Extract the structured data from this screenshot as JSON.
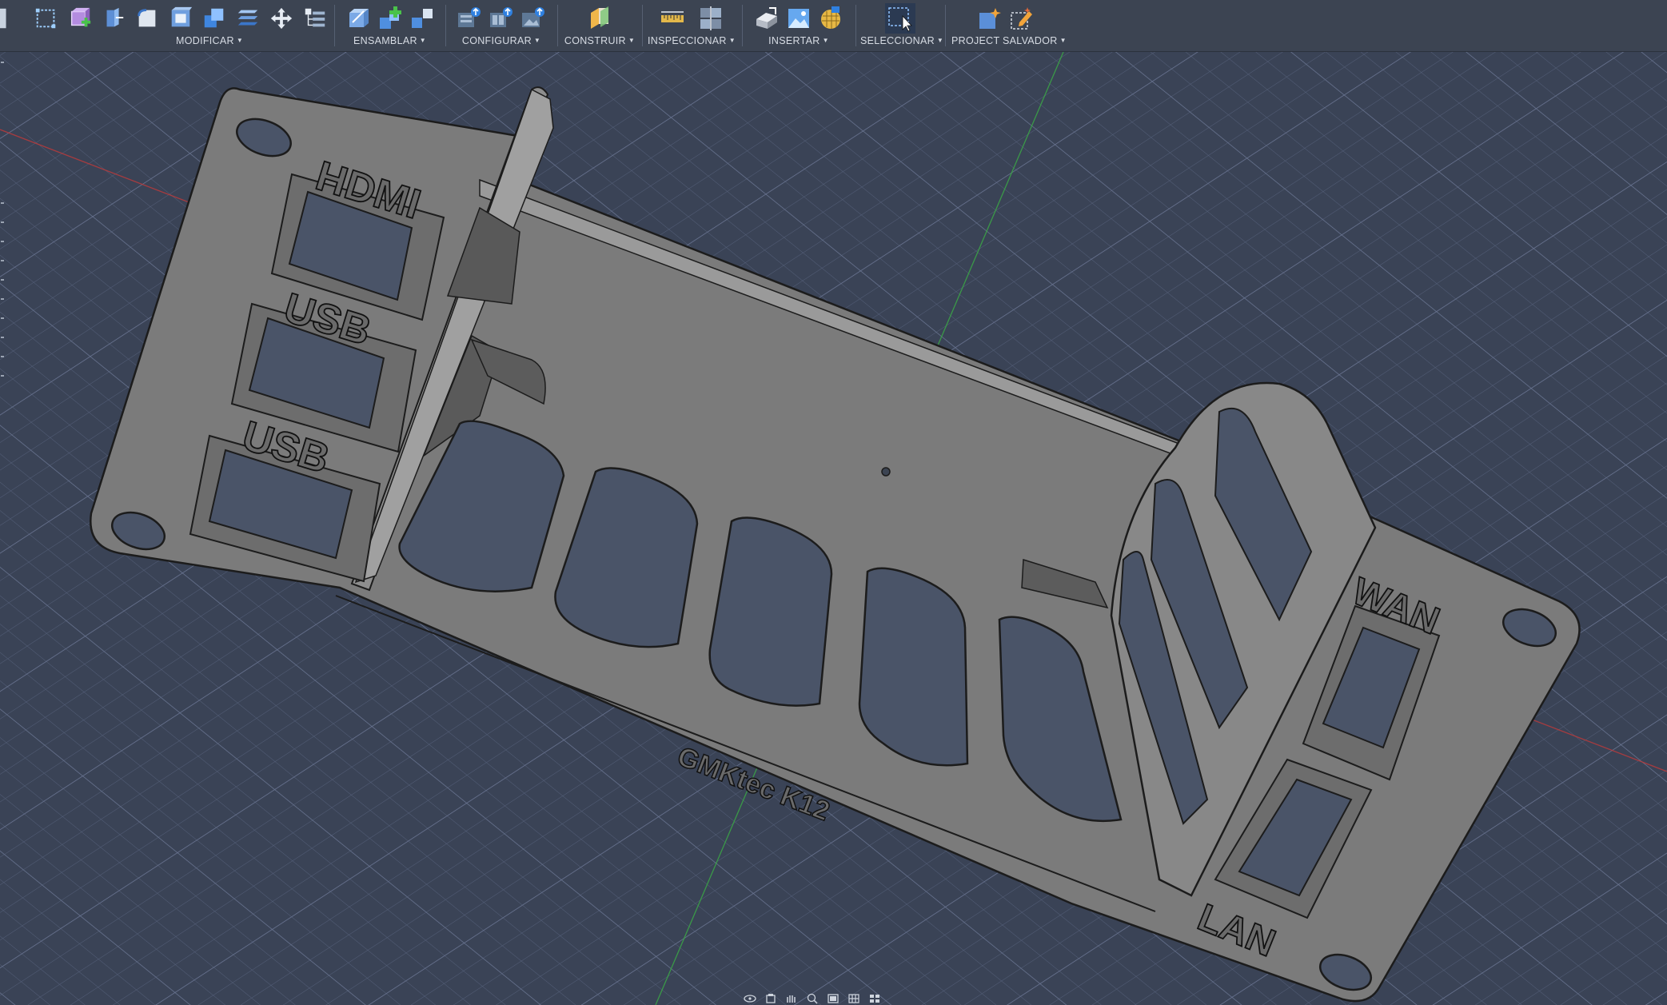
{
  "toolbar": {
    "groups": [
      {
        "label": "MODIFICAR",
        "icons": [
          "press-pull-icon",
          "fillet-icon",
          "shell-icon",
          "combine-icon",
          "offset-face-icon",
          "move-icon",
          "compute-icon"
        ]
      },
      {
        "label": "ENSAMBLAR",
        "icons": [
          "new-component-icon",
          "joint-icon",
          "as-built-joint-icon"
        ]
      },
      {
        "label": "CONFIGURAR",
        "icons": [
          "configure-table-icon",
          "configure-rule-icon",
          "configure-theme-icon"
        ]
      },
      {
        "label": "CONSTRUIR",
        "icons": [
          "offset-plane-icon"
        ]
      },
      {
        "label": "INSPECCIONAR",
        "icons": [
          "measure-icon",
          "section-analysis-icon"
        ]
      },
      {
        "label": "INSERTAR",
        "icons": [
          "insert-derive-icon",
          "insert-image-icon",
          "insert-mesh-icon"
        ]
      },
      {
        "label": "SELECCIONAR",
        "icons": [
          "window-select-icon"
        ]
      },
      {
        "label": "PROJECT SALVADOR",
        "icons": [
          "project-add-icon",
          "project-edit-icon"
        ]
      }
    ]
  },
  "model": {
    "engravings": {
      "hdmi": "HDMI",
      "usb_top": "USB",
      "usb_bottom": "USB",
      "wan": "WAN",
      "lan": "LAN",
      "product": "GMKtec K12"
    }
  },
  "colors": {
    "toolbar_bg": "#3c4452",
    "viewport_bg": "#3a4356",
    "grid_line": "#56607a",
    "grid_major": "#6a7590",
    "model_fill": "#7a7a7a",
    "model_edge": "#1e1e1e",
    "axis_x": "#c23a3a",
    "axis_y": "#3aa846"
  },
  "navigation_bar": {
    "icons": [
      "orbit-icon",
      "pan-icon",
      "look-at-icon",
      "zoom-icon",
      "display-settings-icon",
      "grid-settings-icon",
      "viewports-icon"
    ]
  }
}
